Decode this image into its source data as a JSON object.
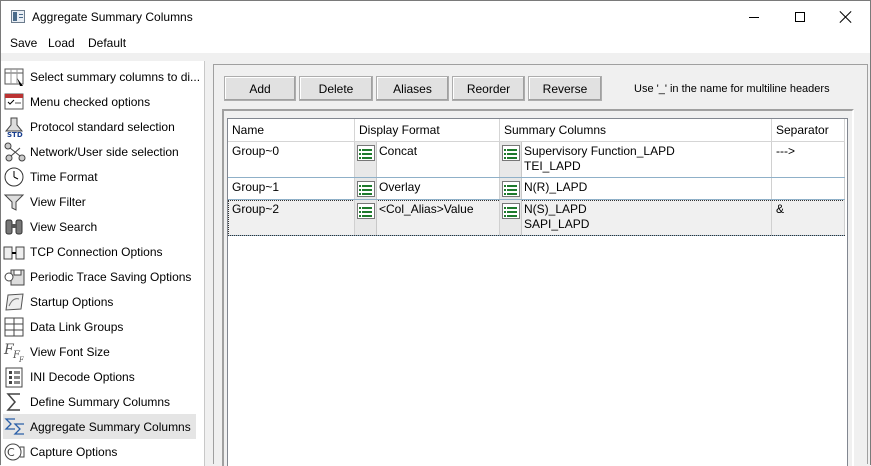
{
  "window": {
    "title": "Aggregate Summary Columns"
  },
  "menu": {
    "items": [
      "Save",
      "Load",
      "Default"
    ]
  },
  "sidebar": {
    "items": [
      {
        "label": "Select summary columns to di...",
        "icon": "columns-select-icon"
      },
      {
        "label": "Menu checked options",
        "icon": "menu-check-icon"
      },
      {
        "label": "Protocol standard selection",
        "icon": "std-icon"
      },
      {
        "label": "Network/User side selection",
        "icon": "network-user-icon"
      },
      {
        "label": "Time Format",
        "icon": "clock-icon"
      },
      {
        "label": "View Filter",
        "icon": "filter-icon"
      },
      {
        "label": "View Search",
        "icon": "binoculars-icon"
      },
      {
        "label": "TCP Connection Options",
        "icon": "tcp-connection-icon"
      },
      {
        "label": "Periodic Trace Saving Options",
        "icon": "periodic-save-icon"
      },
      {
        "label": "Startup Options",
        "icon": "startup-icon"
      },
      {
        "label": "Data Link Groups",
        "icon": "data-link-icon"
      },
      {
        "label": "View Font Size",
        "icon": "font-size-icon"
      },
      {
        "label": "INI Decode Options",
        "icon": "ini-decode-icon"
      },
      {
        "label": "Define Summary Columns",
        "icon": "sigma-icon"
      },
      {
        "label": "Aggregate Summary Columns",
        "icon": "aggregate-sigma-icon"
      },
      {
        "label": "Capture Options",
        "icon": "capture-icon"
      }
    ],
    "selected_index": 14
  },
  "toolbar": {
    "add": "Add",
    "delete": "Delete",
    "aliases": "Aliases",
    "reorder": "Reorder",
    "reverse": "Reverse",
    "hint": "Use '_' in the name for multiline headers"
  },
  "grid": {
    "headers": [
      "Name",
      "Display Format",
      "Summary Columns",
      "Separator"
    ],
    "rows": [
      {
        "name": "Group~0",
        "format": "Concat",
        "columns": [
          "Supervisory Function_LAPD",
          "TEI_LAPD"
        ],
        "separator": "--->"
      },
      {
        "name": "Group~1",
        "format": "Overlay",
        "columns": [
          "N(R)_LAPD"
        ],
        "separator": ""
      },
      {
        "name": "Group~2",
        "format": "<Col_Alias>Value",
        "columns": [
          "N(S)_LAPD",
          "SAPI_LAPD"
        ],
        "separator": "&"
      }
    ]
  }
}
